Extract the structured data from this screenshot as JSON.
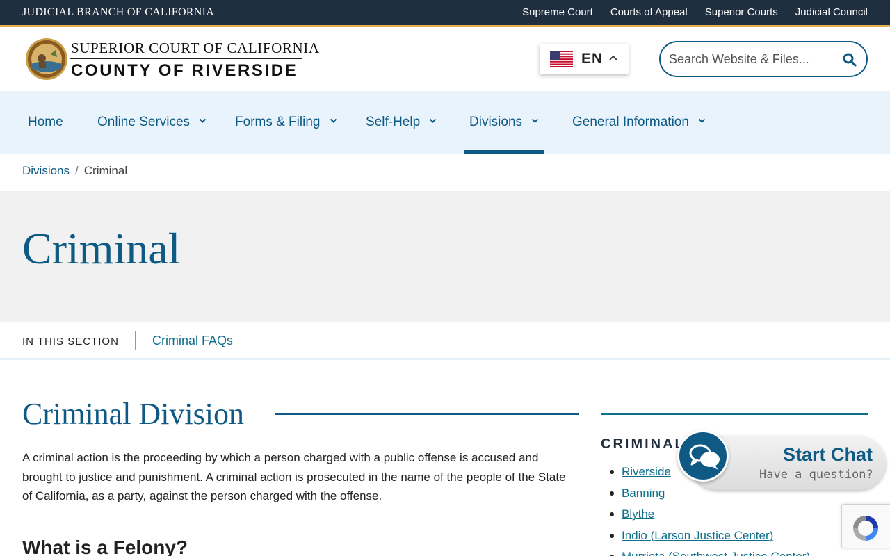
{
  "topbar": {
    "branch": "JUDICIAL BRANCH OF CALIFORNIA",
    "links": [
      "Supreme Court",
      "Courts of Appeal",
      "Superior Courts",
      "Judicial Council"
    ]
  },
  "header": {
    "line1": "SUPERIOR COURT OF CALIFORNIA",
    "line2": "COUNTY OF RIVERSIDE",
    "language": "EN",
    "search_placeholder": "Search Website & Files..."
  },
  "nav": {
    "items": [
      {
        "label": "Home"
      },
      {
        "label": "Online Services"
      },
      {
        "label": "Forms & Filing"
      },
      {
        "label": "Self-Help"
      },
      {
        "label": "Divisions"
      },
      {
        "label": "General Information"
      }
    ],
    "active": "Divisions"
  },
  "breadcrumb": {
    "parent": "Divisions",
    "separator": "/",
    "current": "Criminal"
  },
  "hero": {
    "title": "Criminal"
  },
  "section_nav": {
    "label": "IN THIS SECTION",
    "link": "Criminal FAQs"
  },
  "content": {
    "title": "Criminal Division",
    "paragraph": "A criminal action is the proceeding by which a person charged with a public offense is accused and brought to justice and punishment. A criminal action is prosecuted in the name of the people of the State of California, as a party, against the person charged with the offense.",
    "subheading": "What is a Felony?"
  },
  "sidebar": {
    "heading": "CRIMINAL",
    "items": [
      "Riverside",
      "Banning",
      "Blythe",
      "Indio (Larson Justice Center)",
      "Murrieta (Southwest Justice Center)"
    ]
  },
  "chat": {
    "title": "Start Chat",
    "subtitle": "Have a question?"
  },
  "colors": {
    "brand_blue": "#0e5a85",
    "topbar": "#1f2f3f",
    "gold": "#e3b04b",
    "nav_bg": "#e9f3fb",
    "hero_bg": "#f1f1f1"
  }
}
